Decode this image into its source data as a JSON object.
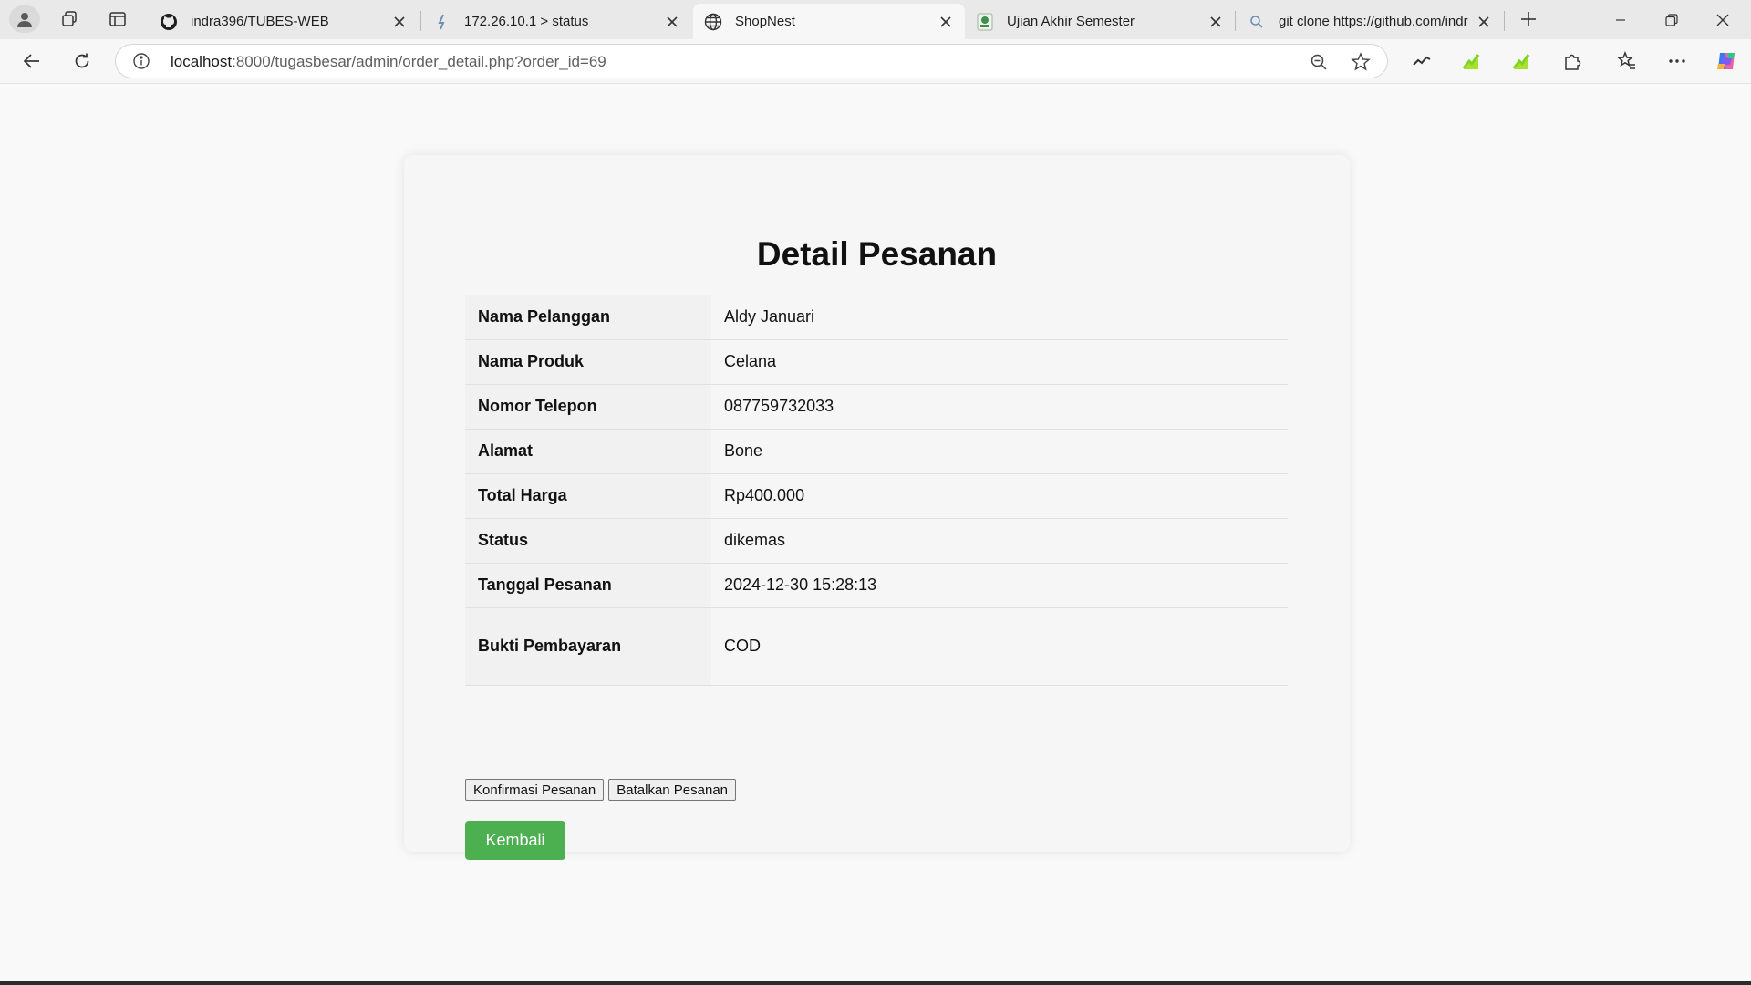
{
  "browser": {
    "tabs": [
      {
        "title": "indra396/TUBES-WEB",
        "icon": "github-icon",
        "active": false
      },
      {
        "title": "172.26.10.1 > status",
        "icon": "router-icon",
        "active": false
      },
      {
        "title": "ShopNest",
        "icon": "globe-icon",
        "active": true
      },
      {
        "title": "Ujian Akhir Semester",
        "icon": "university-logo-icon",
        "active": false
      },
      {
        "title": "git clone https://github.com/indr",
        "icon": "search-icon",
        "active": false
      }
    ],
    "url_host": "localhost",
    "url_rest": ":8000/tugasbesar/admin/order_detail.php?order_id=69",
    "accent_color": "#4caf50"
  },
  "page": {
    "title": "Detail Pesanan",
    "rows": [
      {
        "label": "Nama Pelanggan",
        "value": "Aldy Januari"
      },
      {
        "label": "Nama Produk",
        "value": "Celana"
      },
      {
        "label": "Nomor Telepon",
        "value": "087759732033"
      },
      {
        "label": "Alamat",
        "value": "Bone"
      },
      {
        "label": "Total Harga",
        "value": "Rp400.000"
      },
      {
        "label": "Status",
        "value": "dikemas"
      },
      {
        "label": "Tanggal Pesanan",
        "value": "2024-12-30 15:28:13"
      },
      {
        "label": "Bukti Pembayaran",
        "value": "COD"
      }
    ],
    "confirm_label": "Konfirmasi Pesanan",
    "cancel_label": "Batalkan Pesanan",
    "back_label": "Kembali"
  }
}
